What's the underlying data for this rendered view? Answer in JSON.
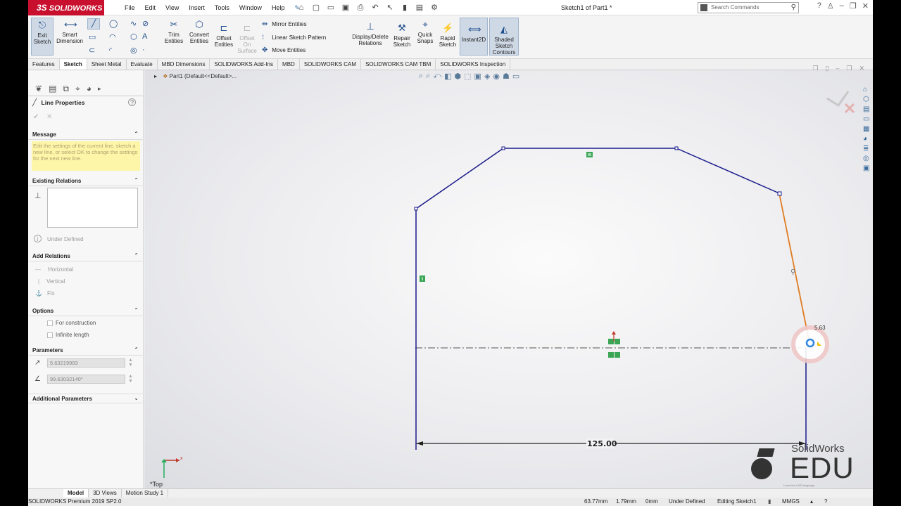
{
  "app": {
    "logo": "SOLIDWORKS",
    "menu": [
      "File",
      "Edit",
      "View",
      "Insert",
      "Tools",
      "Window",
      "Help"
    ],
    "doc_title": "Sketch1 of Part1 *",
    "search_placeholder": "Search Commands"
  },
  "commands": {
    "exit_sketch": "Exit Sketch",
    "smart_dimension": "Smart Dimension",
    "trim_entities": "Trim Entities",
    "convert_entities": "Convert Entities",
    "offset_entities": "Offset Entities",
    "offset_on_surface": "Offset On Surface",
    "mirror_entities": "Mirror Entities",
    "linear_sketch_pattern": "Linear Sketch Pattern",
    "move_entities": "Move Entities",
    "display_delete_relations": "Display/Delete Relations",
    "repair_sketch": "Repair Sketch",
    "quick_snaps": "Quick Snaps",
    "rapid_sketch": "Rapid Sketch",
    "instant2d": "Instant2D",
    "shaded_sketch_contours": "Shaded Sketch Contours"
  },
  "tabs": [
    "Features",
    "Sketch",
    "Sheet Metal",
    "Evaluate",
    "MBD Dimensions",
    "SOLIDWORKS Add-Ins",
    "MBD",
    "SOLIDWORKS CAM",
    "SOLIDWORKS CAM TBM",
    "SOLIDWORKS Inspection"
  ],
  "active_tab": "Sketch",
  "panel": {
    "title": "Line Properties",
    "message_header": "Message",
    "message": "Edit the settings of the current line, sketch a new line, or select OK to change the settings for the next new line.",
    "existing_relations_header": "Existing Relations",
    "under_defined": "Under Defined",
    "add_relations_header": "Add Relations",
    "relations": [
      "Horizontal",
      "Vertical",
      "Fix"
    ],
    "options_header": "Options",
    "options": [
      "For construction",
      "Infinite length"
    ],
    "parameters_header": "Parameters",
    "length_value": "5.63219993",
    "angle_value": "99.63032140°",
    "additional_header": "Additional Parameters"
  },
  "viewport": {
    "tree_label": "Part1  (Default<<Default>...",
    "dimension_label": "125.00",
    "live_length": "5.63",
    "view_label": "*Top",
    "edu_brand": "SolidWorks",
    "edu_text": "EDU",
    "edu_tagline": "Learn the CAD language",
    "axis_x": "x",
    "axis_y": "y"
  },
  "bottom_tabs": [
    "Model",
    "3D Views",
    "Motion Study 1"
  ],
  "active_bottom_tab": "Model",
  "status": {
    "version": "SOLIDWORKS Premium 2019 SP2.0",
    "x": "63.77mm",
    "y": "1.79mm",
    "z": "0mm",
    "state": "Under Defined",
    "editing": "Editing Sketch1",
    "units": "MMGS"
  },
  "colors": {
    "sketch_line": "#1a1a8c",
    "active_line": "#e07b20",
    "relation_badge": "#3aa655",
    "brand": "#c8102e"
  }
}
